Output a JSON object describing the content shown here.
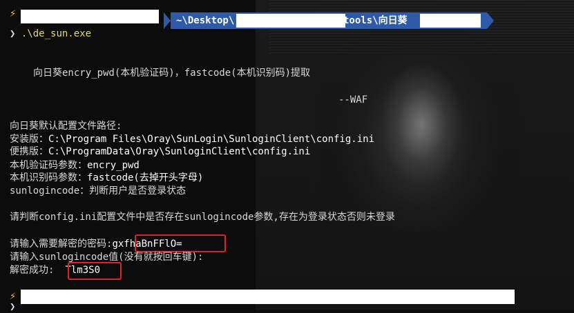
{
  "prompt": {
    "path_prefix": "~\\Desktop\\",
    "path_suffix": "tools\\向日葵"
  },
  "command": {
    "caret": "❯",
    "text": ".\\de_sun.exe"
  },
  "banner": {
    "title": "向日葵encry_pwd(本机验证码)，fastcode(本机识别码)提取",
    "author": "--WAF"
  },
  "info": {
    "heading": "向日葵默认配置文件路径:",
    "install_label": "安装版：",
    "install_path": "C:\\Program Files\\Oray\\SunLogin\\SunloginClient\\config.ini",
    "portable_label": "便携版：",
    "portable_path": "C:\\ProgramData\\Oray\\SunloginClient\\config.ini",
    "verify_label": "本机验证码参数：",
    "verify_value": "encry_pwd",
    "id_label": "本机识别码参数：",
    "id_value": "fastcode(去掉开头字母)",
    "code_label": "sunlogincode：",
    "code_value": "判断用户是否登录状态"
  },
  "hint": "请判断config.ini配置文件中是否存在sunlogincode参数,存在为登录状态否则未登录",
  "input_password": {
    "label": "请输入需要解密的密码:",
    "value": "gxfhaBnFFlO="
  },
  "input_code": {
    "label": "请输入sunlogincode值(没有就按回车键):"
  },
  "result": {
    "label": "解密成功:",
    "value": "Tlm3S0"
  },
  "prompt2": {
    "bolt": "⚡",
    "caret": "❯"
  }
}
